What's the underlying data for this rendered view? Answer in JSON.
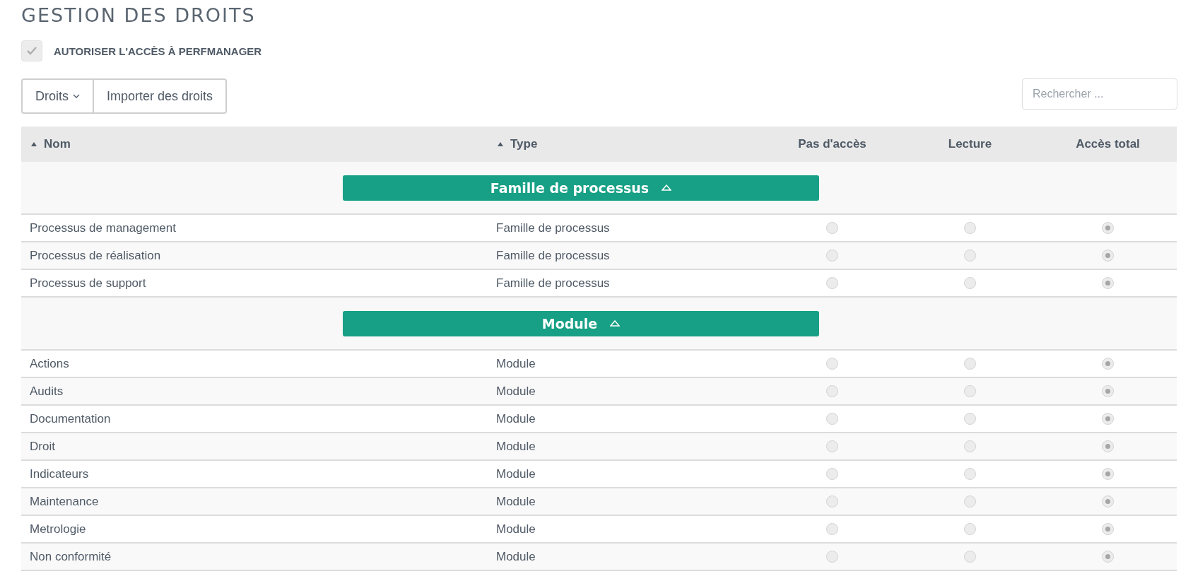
{
  "title": "GESTION DES DROITS",
  "access_checkbox": {
    "label": "AUTORISER L'ACCÈS À PERFMANAGER",
    "checked": true,
    "disabled": true
  },
  "toolbar": {
    "buttons": [
      {
        "label": "Droits",
        "kind": "dropdown"
      },
      {
        "label": "Importer des droits",
        "kind": "plain"
      }
    ],
    "search": {
      "placeholder": "Rechercher ..."
    }
  },
  "table": {
    "columns": [
      {
        "label": "Nom",
        "sortable": true
      },
      {
        "label": "Type",
        "sortable": true
      },
      {
        "label": "Pas d'accès",
        "sortable": false
      },
      {
        "label": "Lecture",
        "sortable": false
      },
      {
        "label": "Accès total",
        "sortable": false
      }
    ],
    "groups": [
      {
        "label": "Famille de processus",
        "expanded": true,
        "rows": [
          {
            "name": "Processus de management",
            "type": "Famille de processus",
            "access": [
              {
                "selected": false
              },
              {
                "selected": false
              },
              {
                "selected": true
              }
            ]
          },
          {
            "name": "Processus de réalisation",
            "type": "Famille de processus",
            "access": [
              {
                "selected": false
              },
              {
                "selected": false
              },
              {
                "selected": true
              }
            ]
          },
          {
            "name": "Processus de support",
            "type": "Famille de processus",
            "access": [
              {
                "selected": false
              },
              {
                "selected": false
              },
              {
                "selected": true
              }
            ]
          }
        ]
      },
      {
        "label": "Module",
        "expanded": true,
        "rows": [
          {
            "name": "Actions",
            "type": "Module",
            "access": [
              {
                "selected": false
              },
              {
                "selected": false
              },
              {
                "selected": true
              }
            ]
          },
          {
            "name": "Audits",
            "type": "Module",
            "access": [
              {
                "selected": false
              },
              {
                "selected": false
              },
              {
                "selected": true
              }
            ]
          },
          {
            "name": "Documentation",
            "type": "Module",
            "access": [
              {
                "selected": false
              },
              {
                "selected": false
              },
              {
                "selected": true
              }
            ]
          },
          {
            "name": "Droit",
            "type": "Module",
            "access": [
              {
                "selected": false
              },
              {
                "selected": false
              },
              {
                "selected": true
              }
            ]
          },
          {
            "name": "Indicateurs",
            "type": "Module",
            "access": [
              {
                "selected": false
              },
              {
                "selected": false
              },
              {
                "selected": true
              }
            ]
          },
          {
            "name": "Maintenance",
            "type": "Module",
            "access": [
              {
                "selected": false
              },
              {
                "selected": false
              },
              {
                "selected": true
              }
            ]
          },
          {
            "name": "Metrologie",
            "type": "Module",
            "access": [
              {
                "selected": false
              },
              {
                "selected": false
              },
              {
                "selected": true
              }
            ]
          },
          {
            "name": "Non conformité",
            "type": "Module",
            "access": [
              {
                "selected": false
              },
              {
                "selected": false
              },
              {
                "selected": true
              }
            ]
          }
        ]
      }
    ]
  }
}
